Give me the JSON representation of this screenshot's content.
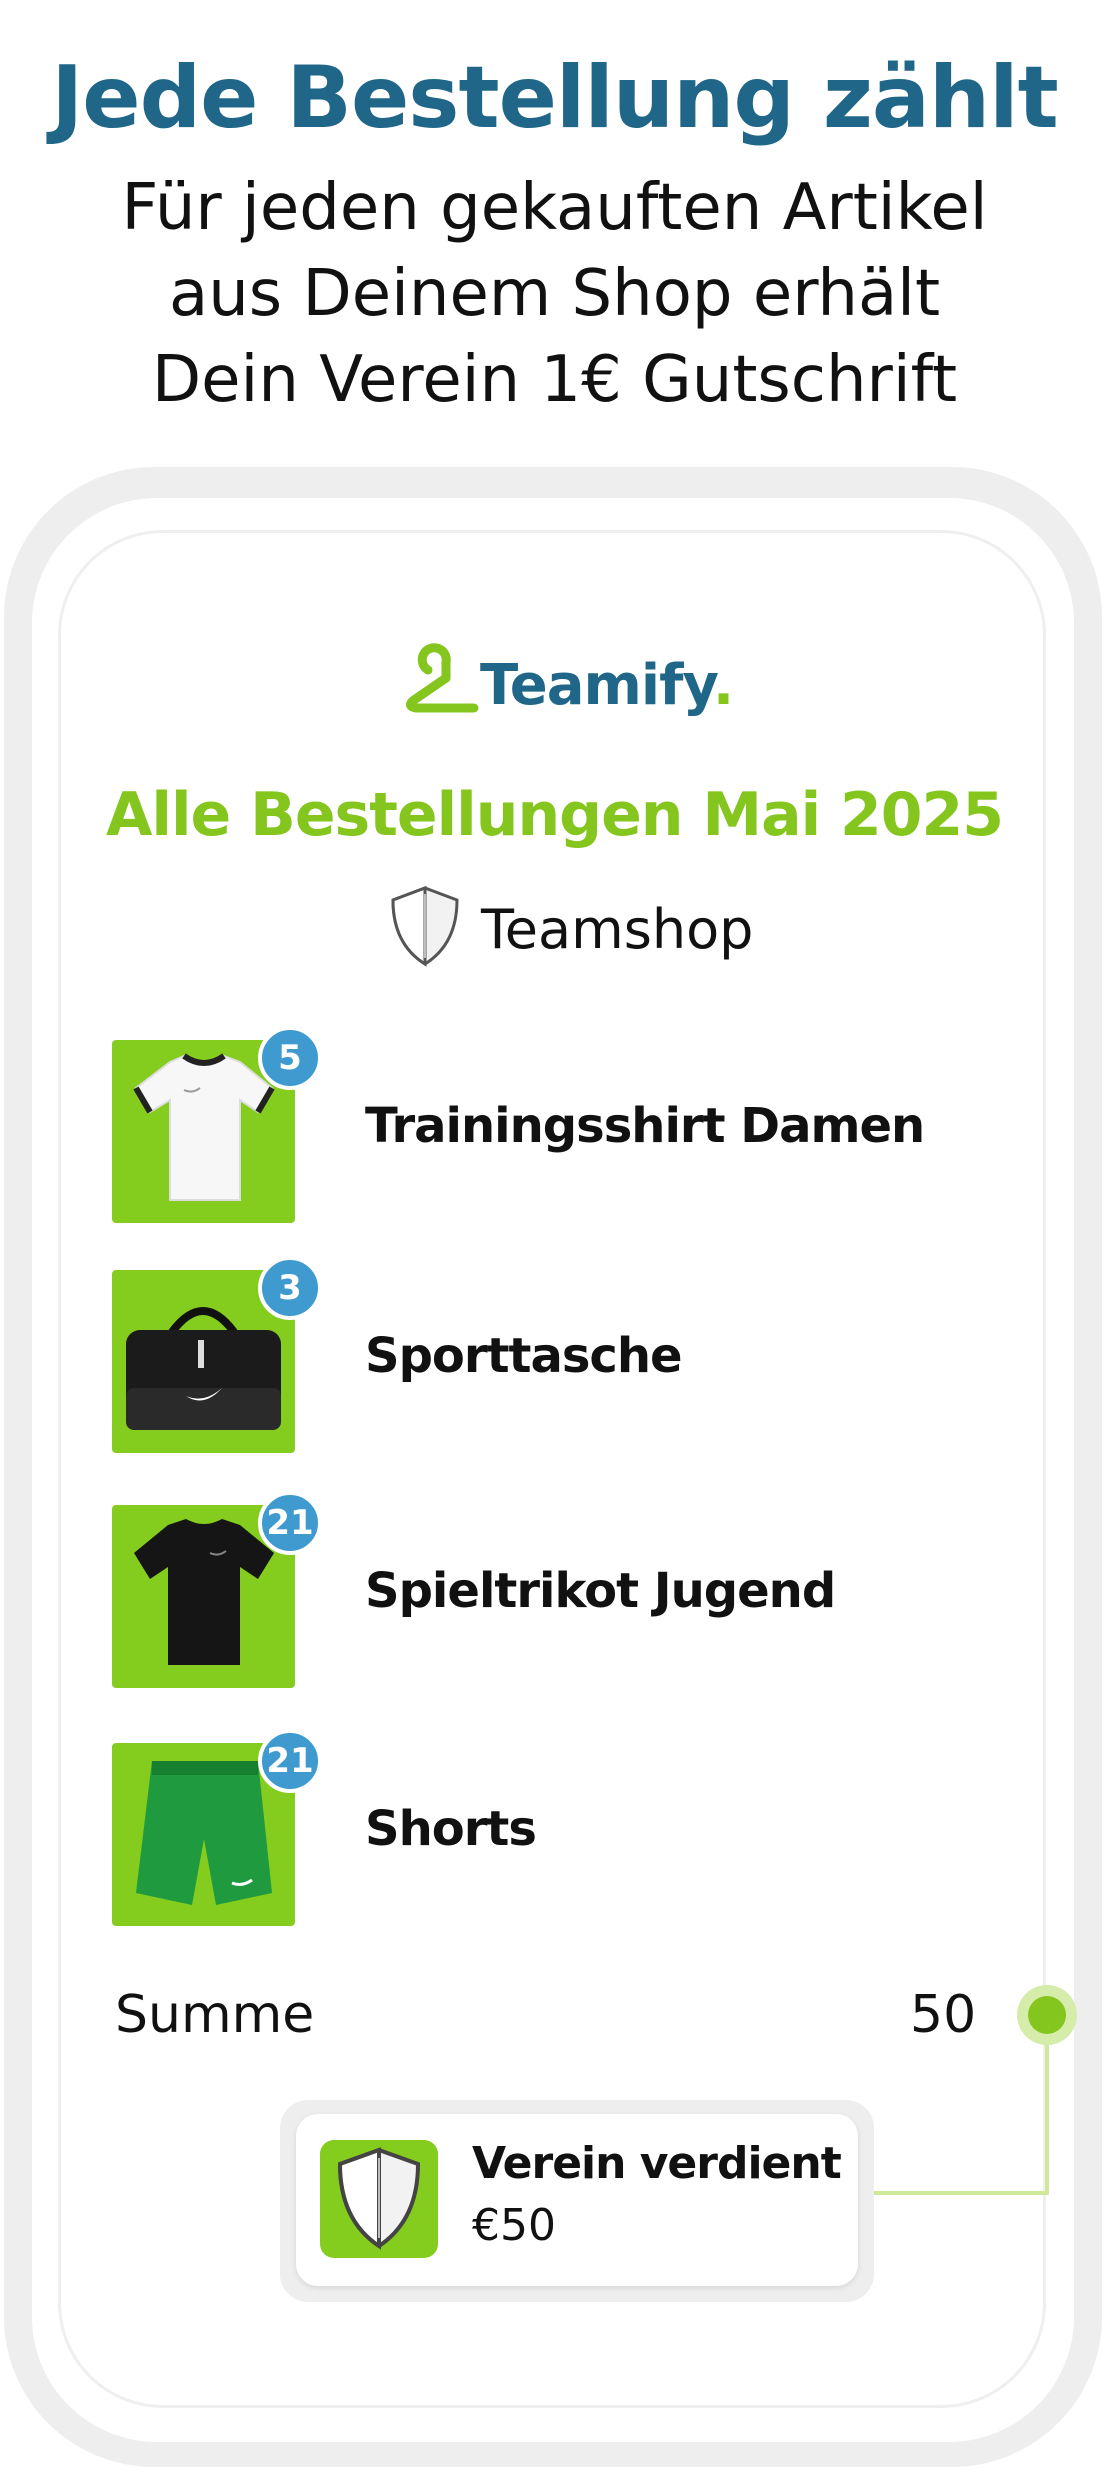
{
  "header": {
    "headline": "Jede Bestellung zählt",
    "subline": [
      "Für jeden gekauften Artikel",
      "aus Deinem Shop erhält",
      "Dein Verein 1€ Gutschrift"
    ]
  },
  "brand": {
    "name": "Teamify",
    "dot": "."
  },
  "orders": {
    "title": "Alle Bestellungen Mai 2025",
    "shop_icon": "shield-icon",
    "shop_label": "Teamshop",
    "items": [
      {
        "name": "Trainingsshirt Damen",
        "count": "5",
        "icon": "white-shirt"
      },
      {
        "name": "Sporttasche",
        "count": "3",
        "icon": "black-bag"
      },
      {
        "name": "Spieltrikot Jugend",
        "count": "21",
        "icon": "black-jersey"
      },
      {
        "name": "Shorts",
        "count": "21",
        "icon": "green-shorts"
      }
    ],
    "sum_label": "Summe",
    "sum_value": "50"
  },
  "earnings": {
    "title": "Verein verdient",
    "amount": "€50",
    "icon": "shield-icon"
  },
  "colors": {
    "headline": "#1f6688",
    "accent_green": "#84c51e",
    "badge_blue": "#3f9ad0",
    "thumb_green": "#84cc1e"
  }
}
